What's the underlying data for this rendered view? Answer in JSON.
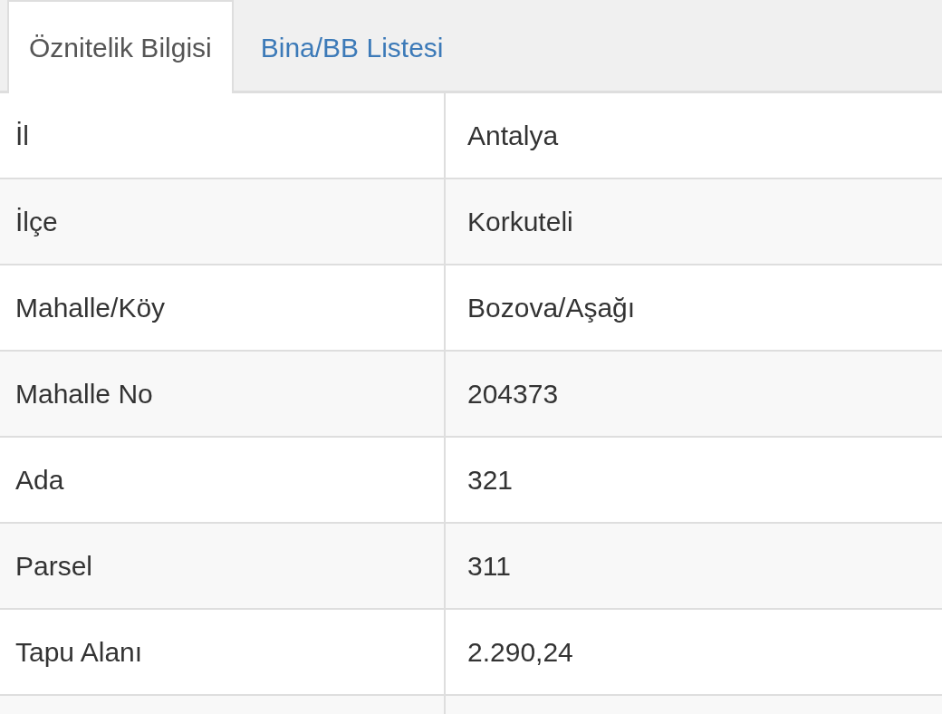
{
  "tabs": [
    {
      "label": "Öznitelik Bilgisi",
      "selected": true
    },
    {
      "label": "Bina/BB Listesi",
      "selected": false
    }
  ],
  "rows": [
    {
      "label": "İl",
      "value": "Antalya"
    },
    {
      "label": "İlçe",
      "value": "Korkuteli"
    },
    {
      "label": "Mahalle/Köy",
      "value": "Bozova/Aşağı"
    },
    {
      "label": "Mahalle No",
      "value": "204373"
    },
    {
      "label": "Ada",
      "value": "321"
    },
    {
      "label": "Parsel",
      "value": "311"
    },
    {
      "label": "Tapu Alanı",
      "value": "2.290,24"
    }
  ]
}
